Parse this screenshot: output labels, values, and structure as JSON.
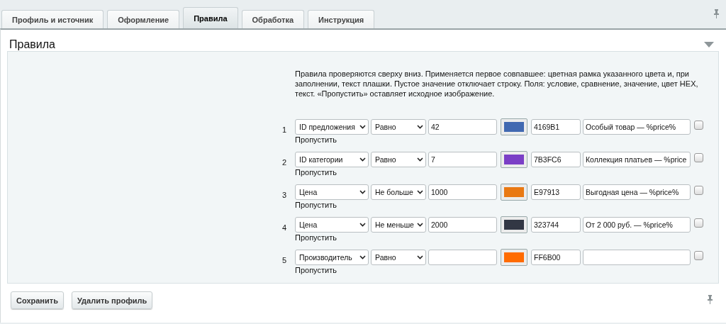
{
  "tabs": [
    {
      "label": "Профиль и источник",
      "selected": false
    },
    {
      "label": "Оформление",
      "selected": false
    },
    {
      "label": "Правила",
      "selected": true
    },
    {
      "label": "Обработка",
      "selected": false
    },
    {
      "label": "Инструкция",
      "selected": false
    }
  ],
  "section": {
    "title": "Правила",
    "expanded": true
  },
  "description": "Правила проверяются сверху вниз. Применяется первое совпавшее: цветная рамка указанного цвета и, при заполнении, текст плашки. Пустое значение отключает строку. Поля: условие, сравнение, значение, цвет HEX, текст. «Пропустить» оставляет исходное изображение.",
  "rules": [
    {
      "number": "1",
      "condition": "ID предложения",
      "comparison": "Равно",
      "value": "42",
      "color": "#4169b1",
      "hex": "4169B1",
      "text": "Особый товар — %price%",
      "skip": false,
      "skip_label": "Пропустить"
    },
    {
      "number": "2",
      "condition": "ID категории",
      "comparison": "Равно",
      "value": "7",
      "color": "#7b3fc6",
      "hex": "7B3FC6",
      "text": "Коллекция платьев — %price",
      "skip": false,
      "skip_label": "Пропустить"
    },
    {
      "number": "3",
      "condition": "Цена",
      "comparison": "Не больше",
      "value": "1000",
      "color": "#e97913",
      "hex": "E97913",
      "text": "Выгодная цена — %price%",
      "skip": false,
      "skip_label": "Пропустить"
    },
    {
      "number": "4",
      "condition": "Цена",
      "comparison": "Не меньше",
      "value": "2000",
      "color": "#323744",
      "hex": "323744",
      "text": "От 2 000 руб. — %price%",
      "skip": false,
      "skip_label": "Пропустить"
    },
    {
      "number": "5",
      "condition": "Производитель",
      "comparison": "Равно",
      "color": "#ff6b00",
      "hex": "FF6B00",
      "skip": false,
      "skip_label": "Пропустить"
    }
  ],
  "buttons": [
    "Сохранить",
    "Удалить профиль"
  ]
}
